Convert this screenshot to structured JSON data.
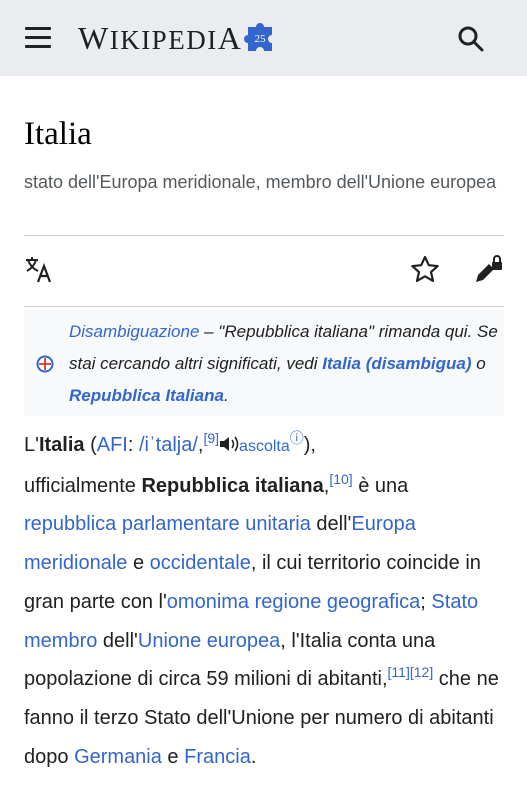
{
  "header": {
    "logo_text": "Wikipedia",
    "logo_cap_start": "W",
    "logo_mid": "IKIPEDI",
    "logo_cap_end": "A",
    "accent": "#3366cc",
    "puzzle_badge": "25"
  },
  "page": {
    "title": "Italia",
    "subtitle": "stato dell'Europa meridionale, membro dell'Unione europea"
  },
  "hatnote": {
    "link_disambig": "Disambiguazione",
    "text_1": " – \"Repubblica italiana\" rimanda qui. Se stai cercando altri significati, vedi ",
    "link_italia": "Italia (disambigua)",
    "text_2": " o ",
    "link_repubblica": "Repubblica Italiana",
    "text_3": "."
  },
  "article": {
    "t01": "L'",
    "t02": "Italia",
    "t03": " (",
    "t04": "AFI",
    "t05": ": ",
    "t06": "/iˈtalja/",
    "t07": ",",
    "ref_9": "[9]",
    "audio_label": "ascolta",
    "audio_info": "ⓘ",
    "t08": "),",
    "t09": "ufficialmente ",
    "t10": "Repubblica italiana",
    "t11": ",",
    "ref_10": "[10]",
    "t12": " è una ",
    "link_repubblica_parlamentare": "repubblica parlamentare unitaria",
    "t13": " dell'",
    "link_europa_meridionale": "Europa meridionale",
    "t14": " e ",
    "link_occidentale": "occidentale",
    "t15": ", il cui territorio coincide in gran parte con l'",
    "link_regione_geografica": "omonima regione geografica",
    "t16": "; ",
    "link_stato_membro": "Stato membro",
    "t17": " dell'",
    "link_unione_europea": "Unione europea",
    "t18": ", l'Italia conta una popolazione di circa 59 milioni di abitanti,",
    "ref_11": "[11]",
    "ref_12": "[12]",
    "t19": " che ne fanno il terzo Stato dell'Unione per numero di abitanti dopo ",
    "link_germania": "Germania",
    "t20": " e ",
    "link_francia": "Francia",
    "t21": "."
  }
}
